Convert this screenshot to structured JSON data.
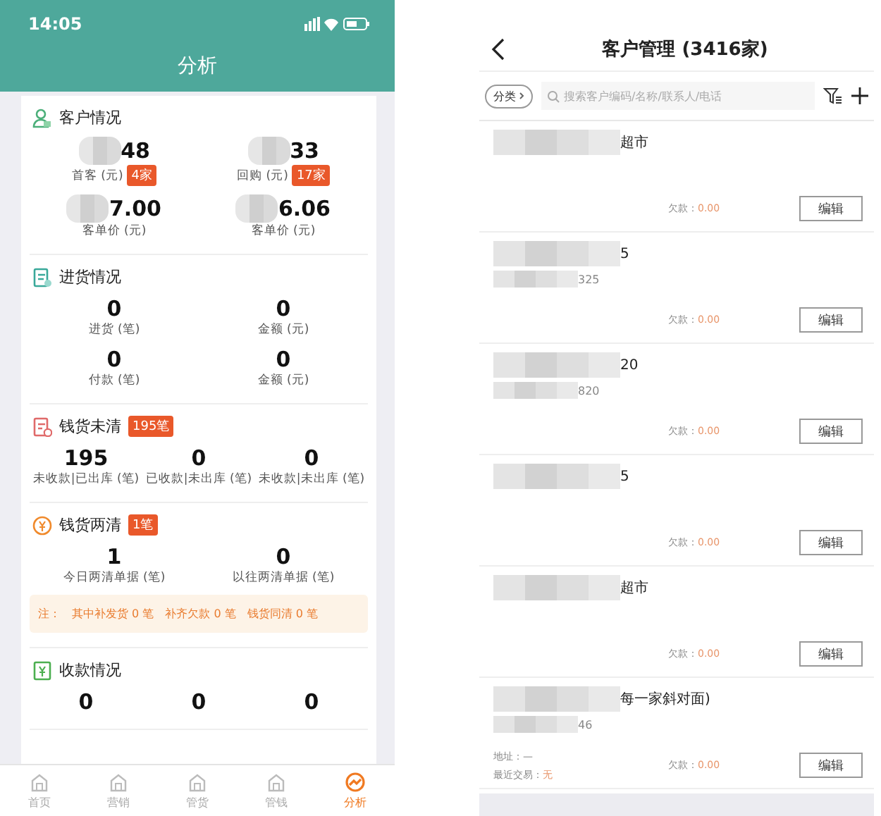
{
  "analysis": {
    "status_bar": {
      "time": "14:05"
    },
    "title": "分析",
    "sections": [
      {
        "title": "客户情况",
        "stats": [
          {
            "value": "48",
            "label": "首客 (元)",
            "badge": "4家",
            "redacted": true
          },
          {
            "value": "33",
            "label": "回购 (元)",
            "badge": "17家",
            "redacted": true
          },
          {
            "value": "7.00",
            "label": "客单价 (元)",
            "redacted": true
          },
          {
            "value": "6.06",
            "label": "客单价 (元)",
            "redacted": true
          }
        ]
      },
      {
        "title": "进货情况",
        "stats": [
          {
            "value": "0",
            "label": "进货 (笔)"
          },
          {
            "value": "0",
            "label": "金额 (元)"
          },
          {
            "value": "0",
            "label": "付款 (笔)"
          },
          {
            "value": "0",
            "label": "金额 (元)"
          }
        ]
      },
      {
        "title": "钱货未清",
        "badge": "195笔",
        "stats": [
          {
            "value": "195",
            "label": "未收款|已出库 (笔)"
          },
          {
            "value": "0",
            "label": "已收款|未出库 (笔)"
          },
          {
            "value": "0",
            "label": "未收款|未出库 (笔)"
          }
        ]
      },
      {
        "title": "钱货两清",
        "badge": "1笔",
        "stats": [
          {
            "value": "1",
            "label": "今日两清单据 (笔)"
          },
          {
            "value": "0",
            "label": "以往两清单据 (笔)"
          }
        ],
        "note": [
          "注：",
          "其中补发货 0 笔",
          "补齐欠款 0 笔",
          "钱货同清 0 笔"
        ]
      },
      {
        "title": "收款情况",
        "stats": [
          {
            "value": "0"
          },
          {
            "value": "0"
          },
          {
            "value": "0"
          }
        ]
      }
    ],
    "tabs": [
      {
        "label": "首页",
        "selected": false
      },
      {
        "label": "营销",
        "selected": false
      },
      {
        "label": "管货",
        "selected": false
      },
      {
        "label": "管钱",
        "selected": false
      },
      {
        "label": "分析",
        "selected": true
      }
    ]
  },
  "customers": {
    "title": "客户管理 (3416家)",
    "category_chip": "分类",
    "search": {
      "placeholder": "搜索客户编码/名称/联系人/电话"
    },
    "rows": [
      {
        "name": "超市",
        "debt_label": "欠款：",
        "debt": "0.00",
        "button": "编辑",
        "redacted": true
      },
      {
        "name": "5",
        "code": "325",
        "debt_label": "欠款：",
        "debt": "0.00",
        "button": "编辑",
        "redacted": true
      },
      {
        "name": "20",
        "code": "820",
        "debt_label": "欠款：",
        "debt": "0.00",
        "button": "编辑",
        "redacted": true
      },
      {
        "name": "5",
        "debt_label": "欠款：",
        "debt": "0.00",
        "button": "编辑",
        "redacted": true
      },
      {
        "name": "超市",
        "debt_label": "欠款：",
        "debt": "0.00",
        "button": "编辑",
        "redacted": true
      },
      {
        "name": "每一家斜对面)",
        "code": "46",
        "address": "地址：—",
        "recent_label": "最近交易：",
        "recent": "无",
        "debt_label": "欠款：",
        "debt": "0.00",
        "button": "编辑",
        "redacted": true
      }
    ]
  }
}
